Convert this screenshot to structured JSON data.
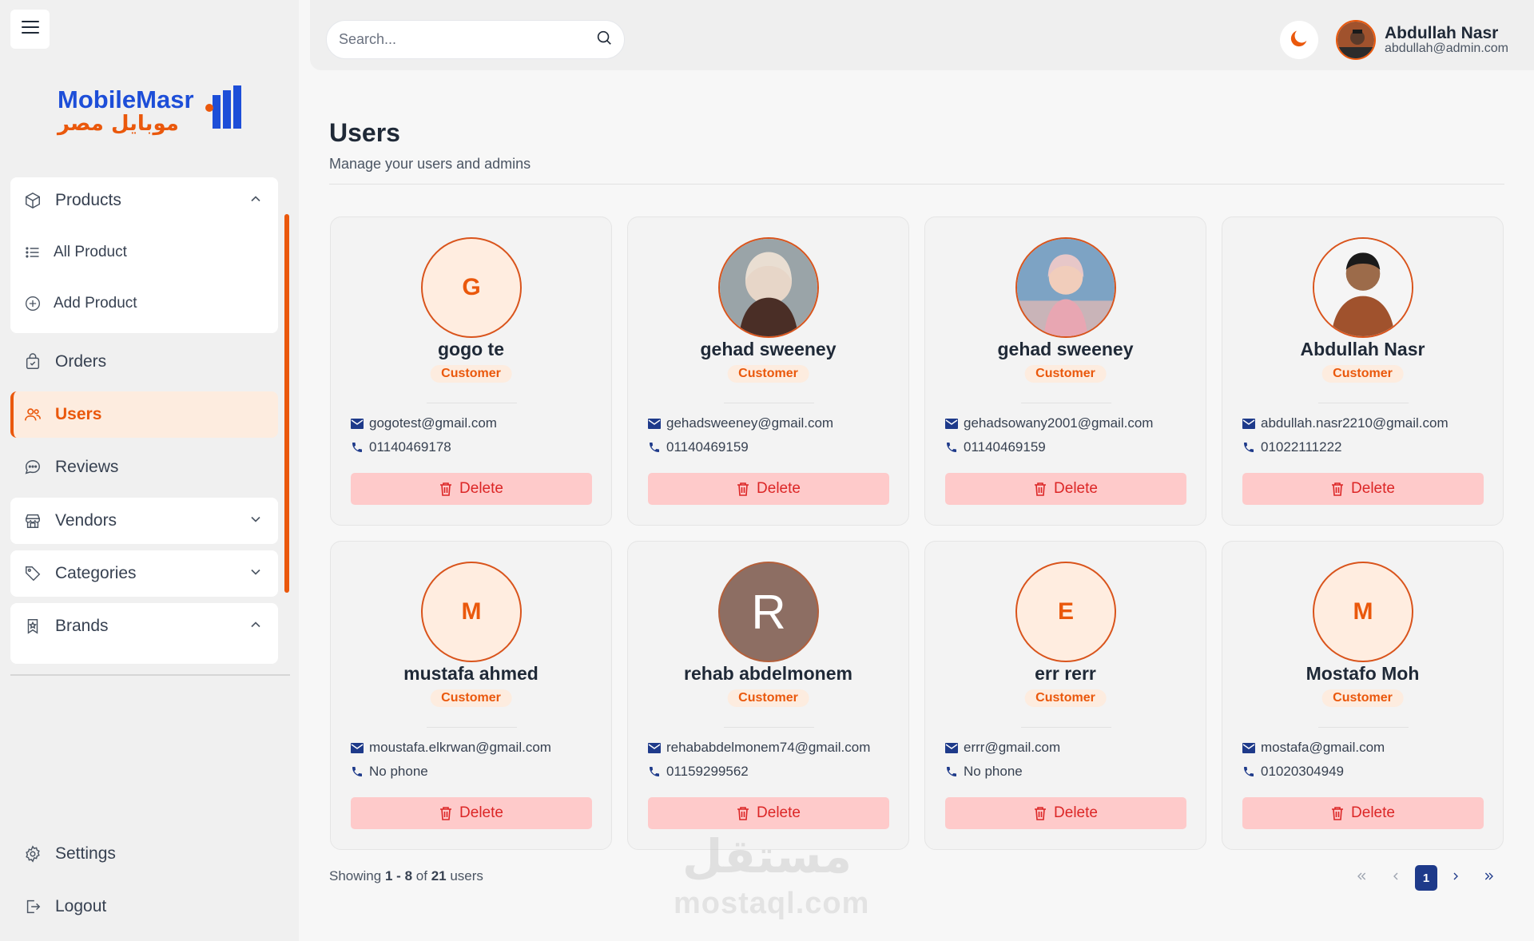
{
  "search": {
    "placeholder": "Search..."
  },
  "header_user": {
    "name": "Abdullah Nasr",
    "email": "abdullah@admin.com"
  },
  "logo": {
    "text_latin": "MobileMasr",
    "text_arabic": "موبايل مصر"
  },
  "sidebar": {
    "products": {
      "label": "Products",
      "sub": [
        {
          "label": "All Product"
        },
        {
          "label": "Add Product"
        }
      ]
    },
    "orders": {
      "label": "Orders"
    },
    "users": {
      "label": "Users"
    },
    "reviews": {
      "label": "Reviews"
    },
    "vendors": {
      "label": "Vendors"
    },
    "categories": {
      "label": "Categories"
    },
    "brands": {
      "label": "Brands"
    },
    "settings": {
      "label": "Settings"
    },
    "logout": {
      "label": "Logout"
    }
  },
  "page": {
    "title": "Users",
    "subtitle": "Manage your users and admins"
  },
  "users": [
    {
      "name": "gogo te",
      "role": "Customer",
      "email": "gogotest@gmail.com",
      "phone": "01140469178",
      "initial": "G",
      "delete": "Delete"
    },
    {
      "name": "gehad sweeney",
      "role": "Customer",
      "email": "gehadsweeney@gmail.com",
      "phone": "01140469159",
      "initial": "",
      "delete": "Delete"
    },
    {
      "name": "gehad sweeney",
      "role": "Customer",
      "email": "gehadsowany2001@gmail.com",
      "phone": "01140469159",
      "initial": "",
      "delete": "Delete"
    },
    {
      "name": "Abdullah Nasr",
      "role": "Customer",
      "email": "abdullah.nasr2210@gmail.com",
      "phone": "01022111222",
      "initial": "",
      "delete": "Delete"
    },
    {
      "name": "mustafa ahmed",
      "role": "Customer",
      "email": "moustafa.elkrwan@gmail.com",
      "phone": "No phone",
      "initial": "M",
      "delete": "Delete"
    },
    {
      "name": "rehab abdelmonem",
      "role": "Customer",
      "email": "rehababdelmonem74@gmail.com",
      "phone": "01159299562",
      "initial": "R",
      "delete": "Delete"
    },
    {
      "name": "err rerr",
      "role": "Customer",
      "email": "errr@gmail.com",
      "phone": "No phone",
      "initial": "E",
      "delete": "Delete"
    },
    {
      "name": "Mostafo Moh",
      "role": "Customer",
      "email": "mostafa@gmail.com",
      "phone": "01020304949",
      "initial": "M",
      "delete": "Delete"
    }
  ],
  "pagination": {
    "prefix": "Showing",
    "from": "1",
    "dash": "-",
    "to": "8",
    "of": "of",
    "total": "21",
    "suffix": "users",
    "current_page": "1"
  },
  "watermark": {
    "arabic": "مستقل",
    "latin": "mostaql.com"
  },
  "colors": {
    "accent": "#ea580c",
    "delete_bg": "#fecaca",
    "delete_text": "#dc2626",
    "pager_active": "#1e3a8a",
    "email_icon": "#1e3a8a"
  }
}
